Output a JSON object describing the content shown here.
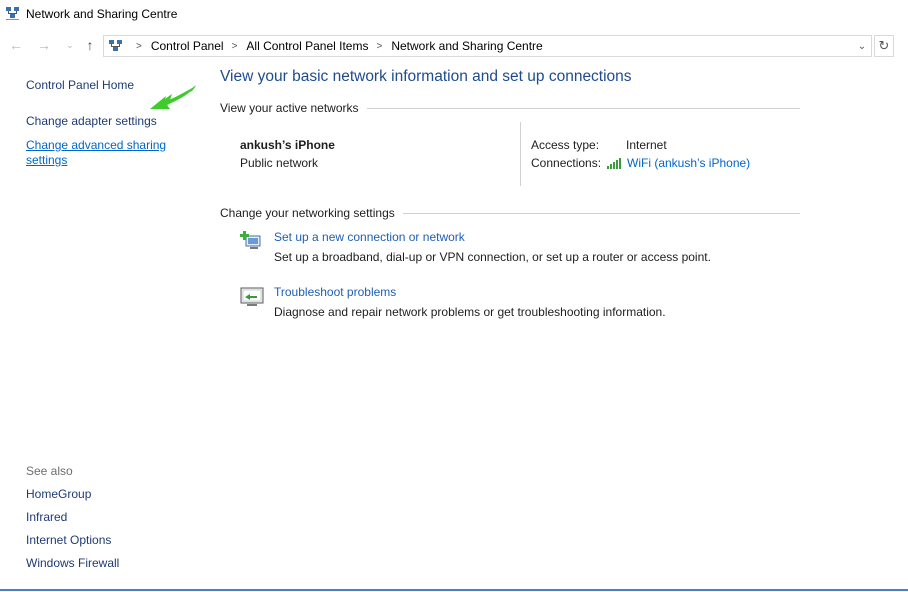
{
  "window": {
    "title": "Network and Sharing Centre"
  },
  "navigation": {
    "back_icon": "back-arrow-icon",
    "forward_icon": "forward-arrow-icon",
    "up_icon": "up-arrow-icon",
    "breadcrumbs": [
      "Control Panel",
      "All Control Panel Items",
      "Network and Sharing Centre"
    ],
    "refresh_icon": "refresh-icon"
  },
  "sidebar": {
    "home": "Control Panel Home",
    "adapter": "Change adapter settings",
    "advanced_line1": "Change advanced sharing",
    "advanced_line2": "settings",
    "see_also_title": "See also",
    "see_also": [
      "HomeGroup",
      "Infrared",
      "Internet Options",
      "Windows Firewall"
    ]
  },
  "main": {
    "title": "View your basic network information and set up connections",
    "active_networks_heading": "View your active networks",
    "network": {
      "name": "ankush’s iPhone",
      "type": "Public network",
      "access_type_label": "Access type:",
      "access_type_value": "Internet",
      "connections_label": "Connections:",
      "connection_name": "WiFi (ankush’s iPhone)"
    },
    "settings_heading": "Change your networking settings",
    "tasks": [
      {
        "link": "Set up a new connection or network",
        "description": "Set up a broadband, dial-up or VPN connection, or set up a router or access point."
      },
      {
        "link": "Troubleshoot problems",
        "description": "Diagnose and repair network problems or get troubleshooting information."
      }
    ]
  },
  "colors": {
    "heading_blue": "#1e4b8f",
    "link_blue": "#0066cc",
    "arrow_green": "#3dcc2a"
  }
}
